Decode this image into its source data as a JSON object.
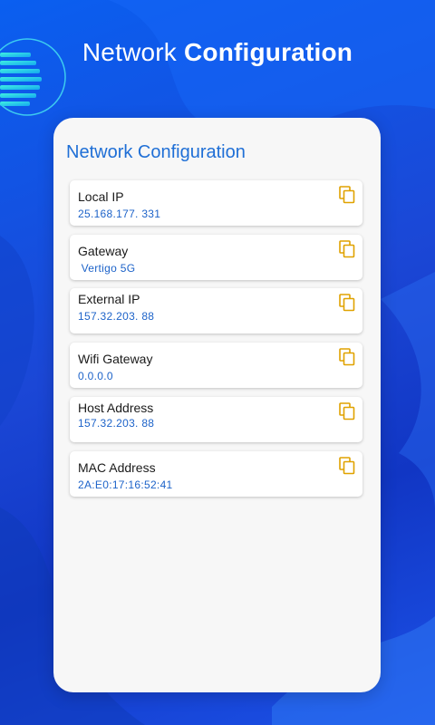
{
  "header": {
    "title_light": "Network",
    "title_bold": "Configuration"
  },
  "card": {
    "title": "Network Configuration",
    "items": [
      {
        "label": "Local IP",
        "value": "25.168.177. 331"
      },
      {
        "label": "Gateway",
        "value": " Vertigo 5G"
      },
      {
        "label": "External IP",
        "value": "157.32.203. 88"
      },
      {
        "label": "Wifi Gateway",
        "value": "0.0.0.0"
      },
      {
        "label": "Host Address",
        "value": "157.32.203. 88"
      },
      {
        "label": "MAC Address",
        "value": "2A:E0:17:16:52:41"
      }
    ]
  },
  "colors": {
    "accent_blue": "#1f6fd6",
    "copy_icon": "#e0a200",
    "background": "#1b47d6"
  },
  "icons": {
    "copy": "copy-icon"
  }
}
